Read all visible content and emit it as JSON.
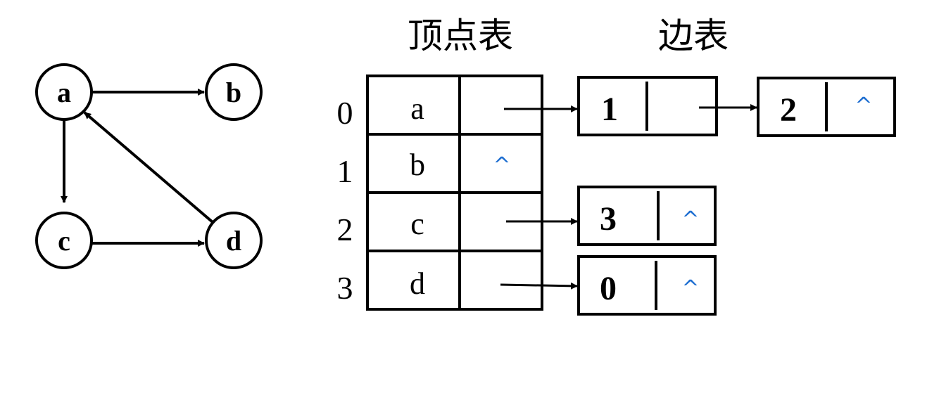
{
  "headers": {
    "vertex_table": "顶点表",
    "edge_table": "边表"
  },
  "graph": {
    "nodes": [
      "a",
      "b",
      "c",
      "d"
    ],
    "edges": [
      [
        "a",
        "b"
      ],
      [
        "a",
        "c"
      ],
      [
        "c",
        "d"
      ],
      [
        "d",
        "a"
      ]
    ]
  },
  "vertex_table": {
    "rows": [
      {
        "index": "0",
        "vertex": "a",
        "pointer": "arrow"
      },
      {
        "index": "1",
        "vertex": "b",
        "pointer": "^"
      },
      {
        "index": "2",
        "vertex": "c",
        "pointer": "arrow"
      },
      {
        "index": "3",
        "vertex": "d",
        "pointer": "arrow"
      }
    ]
  },
  "edge_lists": {
    "row0": [
      {
        "adj": "1",
        "next": "arrow"
      },
      {
        "adj": "2",
        "next": "^"
      }
    ],
    "row2": [
      {
        "adj": "3",
        "next": "^"
      }
    ],
    "row3": [
      {
        "adj": "0",
        "next": "^"
      }
    ]
  },
  "colors": {
    "null_marker": "#1f6fd1",
    "stroke": "#000000"
  }
}
